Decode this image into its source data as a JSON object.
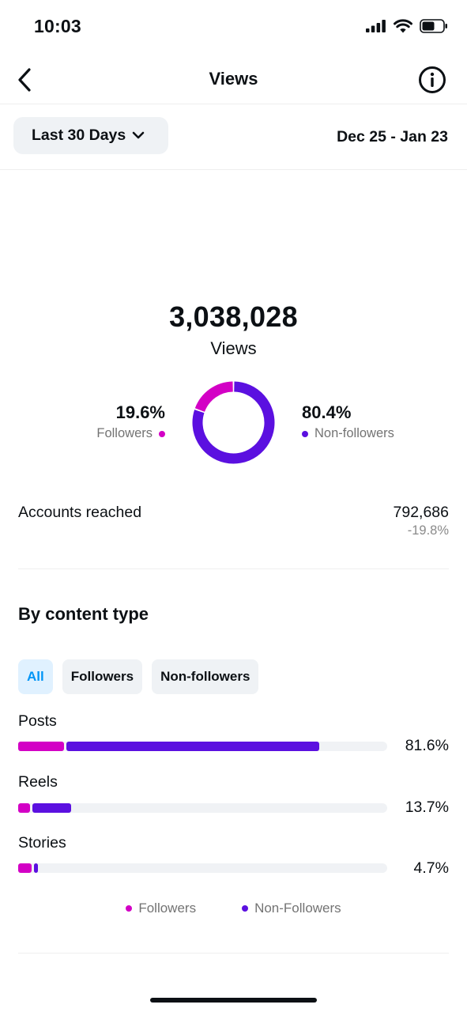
{
  "status_bar": {
    "time": "10:03"
  },
  "nav": {
    "title": "Views"
  },
  "range": {
    "selected": "Last 30 Days",
    "dates": "Dec 25 - Jan 23"
  },
  "summary": {
    "total_value": "3,038,028",
    "total_label": "Views",
    "followers_pct": "19.6%",
    "followers_label": "Followers",
    "non_followers_pct": "80.4%",
    "non_followers_label": "Non-followers",
    "followers_share": 0.196
  },
  "reach": {
    "label": "Accounts reached",
    "value": "792,686",
    "change": "-19.8%"
  },
  "content_type": {
    "title": "By content type",
    "filters": [
      "All",
      "Followers",
      "Non-followers"
    ],
    "active_filter": "All",
    "rows": [
      {
        "label": "Posts",
        "pct": "81.6%",
        "followers_fraction": 0.125,
        "non_followers_fraction": 0.685
      },
      {
        "label": "Reels",
        "pct": "13.7%",
        "followers_fraction": 0.033,
        "non_followers_fraction": 0.105
      },
      {
        "label": "Stories",
        "pct": "4.7%",
        "followers_fraction": 0.037,
        "non_followers_fraction": 0.01
      }
    ],
    "legend": [
      "Followers",
      "Non-Followers"
    ]
  },
  "colors": {
    "followers": "#d300c5",
    "non_followers": "#5b10e0",
    "accent": "#0095f6"
  },
  "icons": [
    "back-chevron-icon",
    "info-icon",
    "chevron-down-icon",
    "signal-icon",
    "wifi-icon",
    "battery-icon"
  ]
}
